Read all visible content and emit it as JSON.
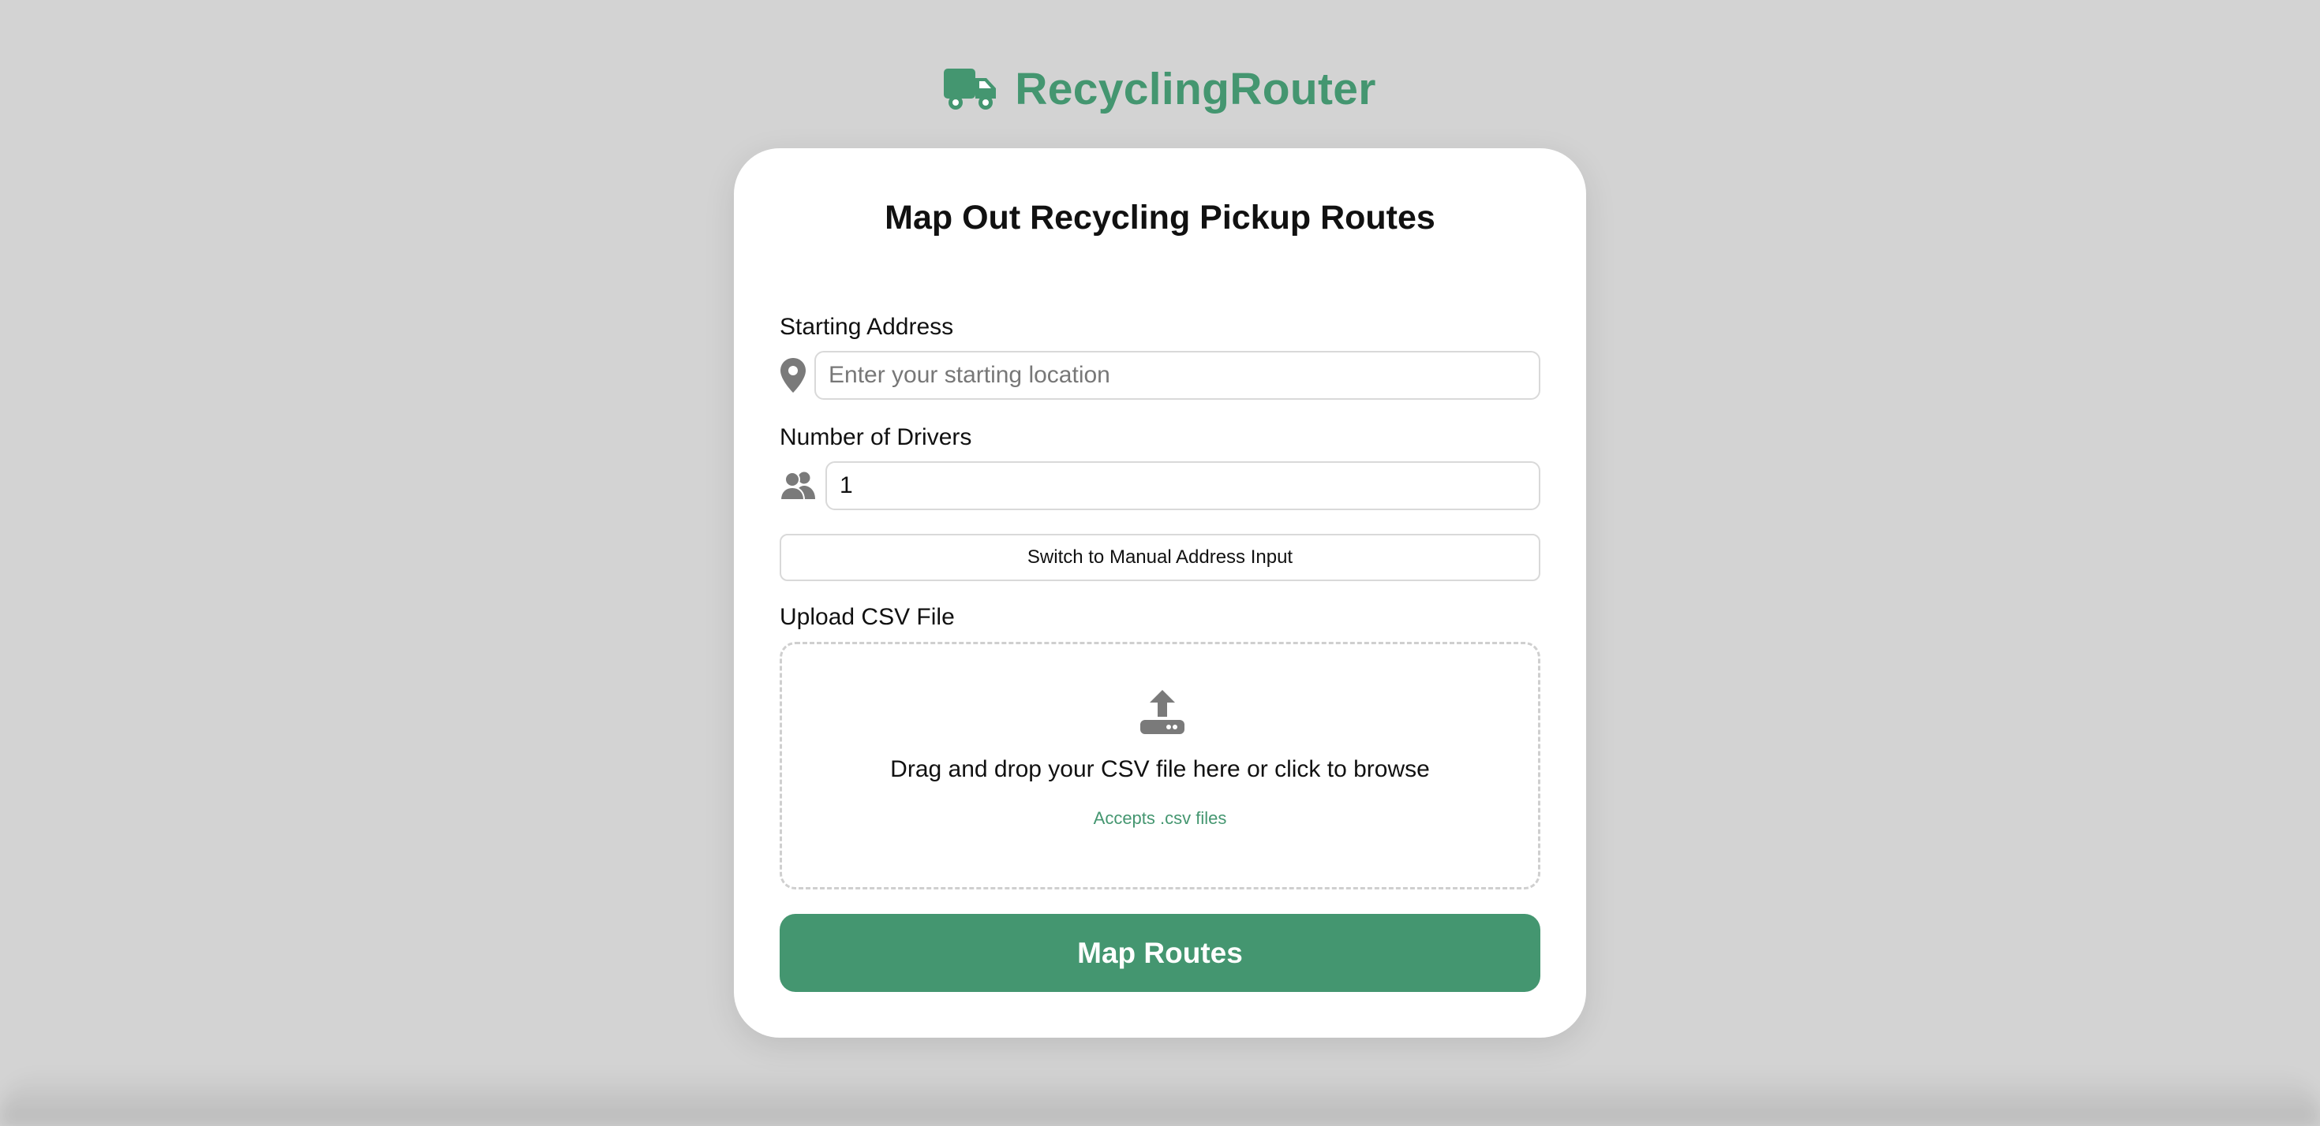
{
  "header": {
    "app_name": "RecyclingRouter",
    "logo_icon": "truck-icon"
  },
  "form": {
    "title": "Map Out Recycling Pickup Routes",
    "starting_address": {
      "label": "Starting Address",
      "icon": "map-pin-icon",
      "placeholder": "Enter your starting location",
      "value": ""
    },
    "drivers": {
      "label": "Number of Drivers",
      "icon": "users-icon",
      "value": "1"
    },
    "switch_button_label": "Switch to Manual Address Input",
    "upload": {
      "label": "Upload CSV File",
      "icon": "upload-icon",
      "instruction": "Drag and drop your CSV file here or click to browse",
      "hint": "Accepts .csv files"
    },
    "submit_label": "Map Routes"
  },
  "colors": {
    "accent": "#449670",
    "background": "#d3d3d3",
    "card": "#ffffff",
    "icon_gray": "#7a7a7a"
  }
}
